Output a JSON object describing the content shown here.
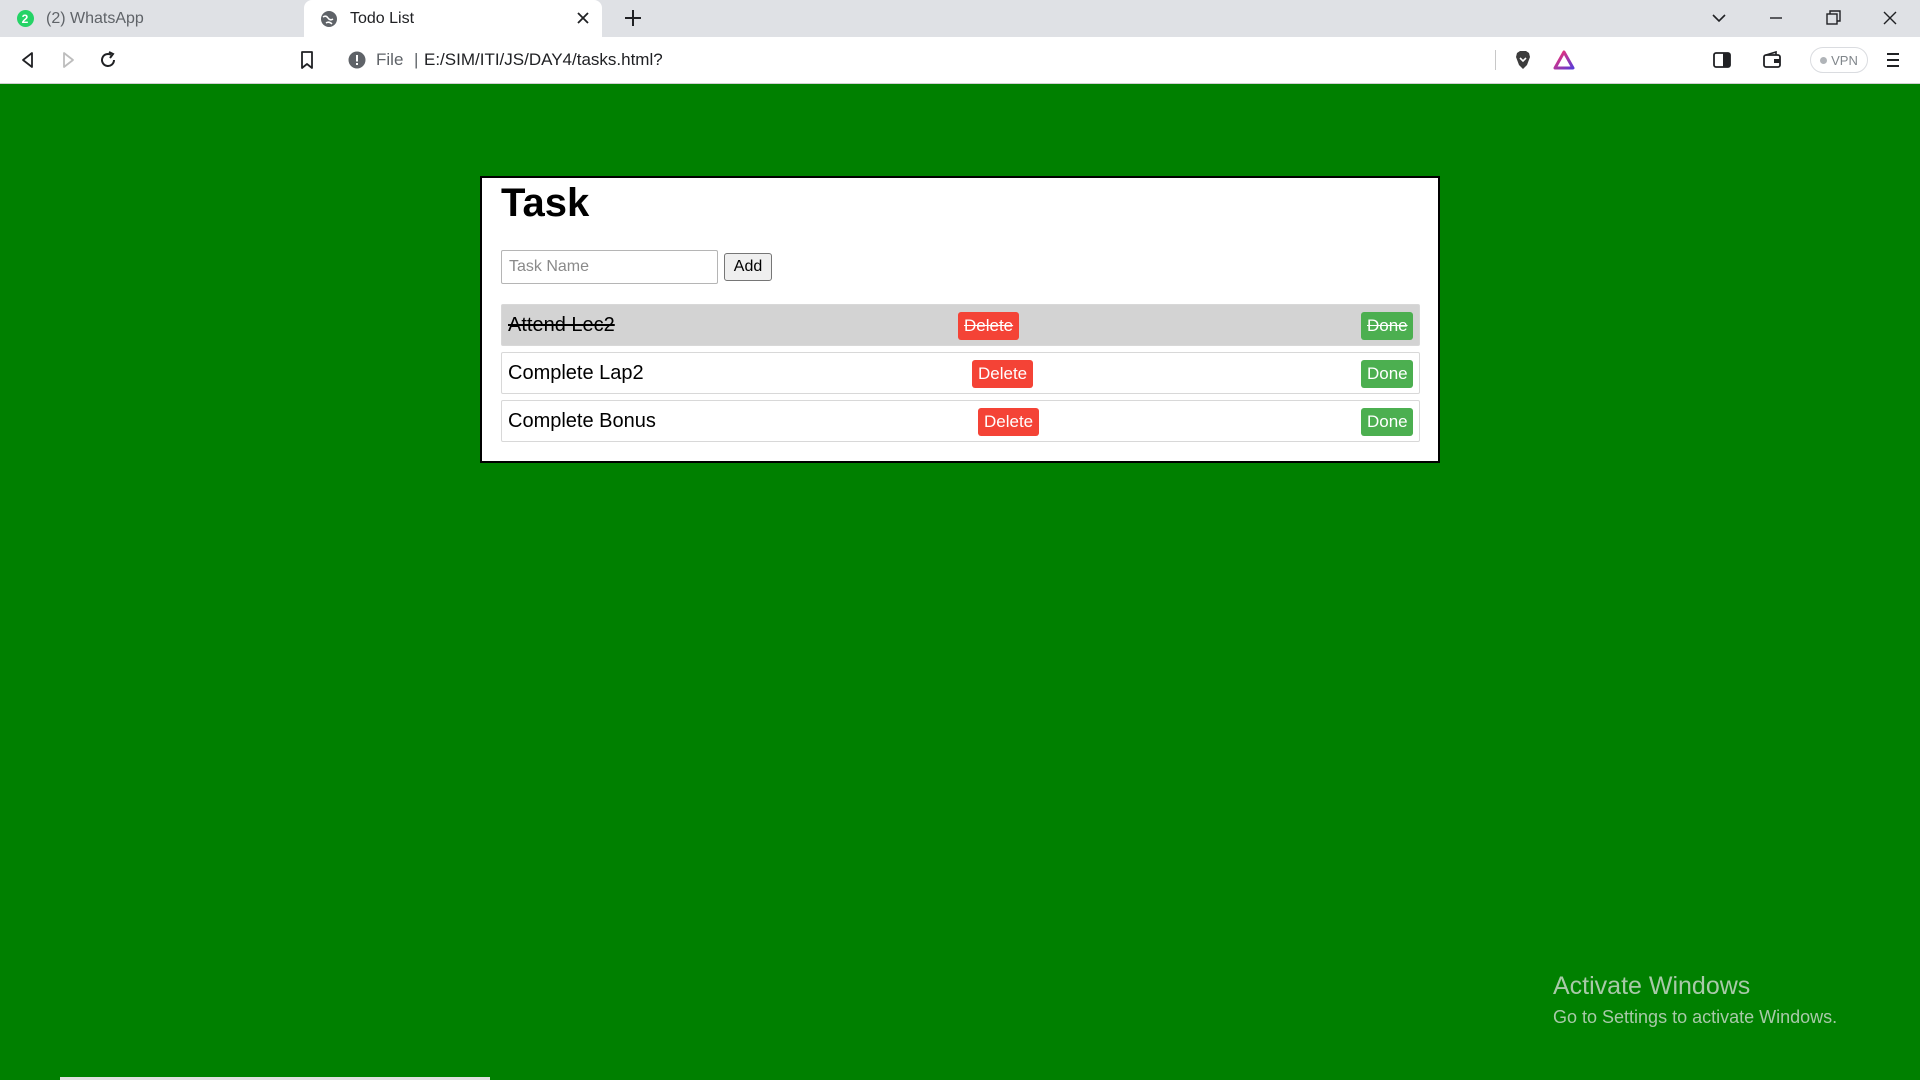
{
  "browser": {
    "tabs": [
      {
        "badge": "2",
        "title": "(2) WhatsApp",
        "active": false
      },
      {
        "title": "Todo List",
        "active": true
      }
    ],
    "address": {
      "scheme_label": "File",
      "separator": "|",
      "url": "E:/SIM/ITI/JS/DAY4/tasks.html?"
    },
    "vpn_label": "VPN"
  },
  "page": {
    "background_color": "#008000",
    "heading": "Task",
    "input": {
      "placeholder": "Task Name",
      "value": ""
    },
    "add_label": "Add",
    "tasks": [
      {
        "name": "Attend Lec2",
        "delete_label": "Delete",
        "done_label": "Done",
        "completed": true
      },
      {
        "name": "Complete Lap2",
        "delete_label": "Delete",
        "done_label": "Done",
        "completed": false
      },
      {
        "name": "Complete Bonus",
        "delete_label": "Delete",
        "done_label": "Done",
        "completed": false
      }
    ],
    "colors": {
      "delete": "#f44336",
      "done": "#4caf50",
      "completed_row": "#d3d3d3"
    }
  },
  "watermark": {
    "title": "Activate Windows",
    "subtitle": "Go to Settings to activate Windows."
  }
}
